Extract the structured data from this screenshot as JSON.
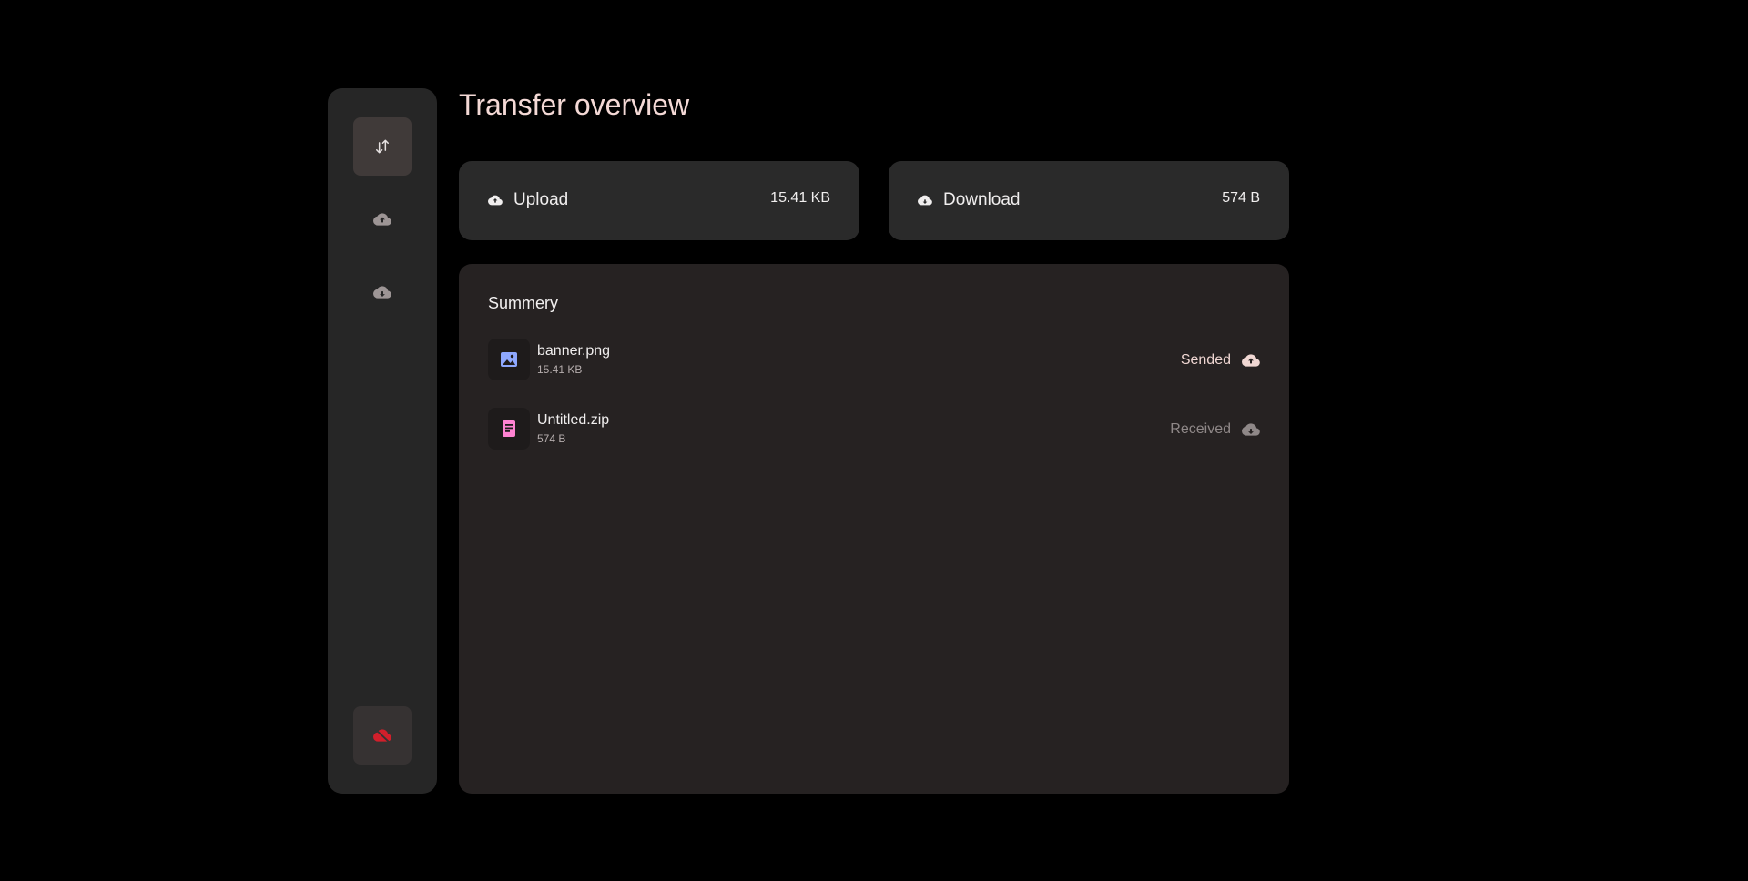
{
  "page": {
    "title": "Transfer overview"
  },
  "sidebar": {
    "items": [
      {
        "name": "transfer",
        "icon": "swap-vertical-icon",
        "active": true
      },
      {
        "name": "upload",
        "icon": "cloud-upload-icon",
        "active": false
      },
      {
        "name": "download",
        "icon": "cloud-download-icon",
        "active": false
      }
    ],
    "bottom": {
      "icon": "cloud-off-icon",
      "color": "#d21f2b"
    }
  },
  "stats": {
    "upload": {
      "label": "Upload",
      "value": "15.41 KB",
      "icon": "cloud-upload-icon"
    },
    "download": {
      "label": "Download",
      "value": "574 B",
      "icon": "cloud-download-icon"
    }
  },
  "summary": {
    "title": "Summery",
    "files": [
      {
        "name": "banner.png",
        "size": "15.41 KB",
        "status": "Sended",
        "icon": "image-file-icon",
        "icon_color": "#8ea8ff",
        "status_icon": "cloud-upload-icon"
      },
      {
        "name": "Untitled.zip",
        "size": "574 B",
        "status": "Received",
        "icon": "document-file-icon",
        "icon_color": "#ff83d2",
        "status_icon": "cloud-download-icon"
      }
    ]
  },
  "colors": {
    "background": "#000000",
    "panel": "#262626",
    "card": "#2a2a2a",
    "accent_title": "#f4d9d6",
    "danger": "#d21f2b"
  }
}
